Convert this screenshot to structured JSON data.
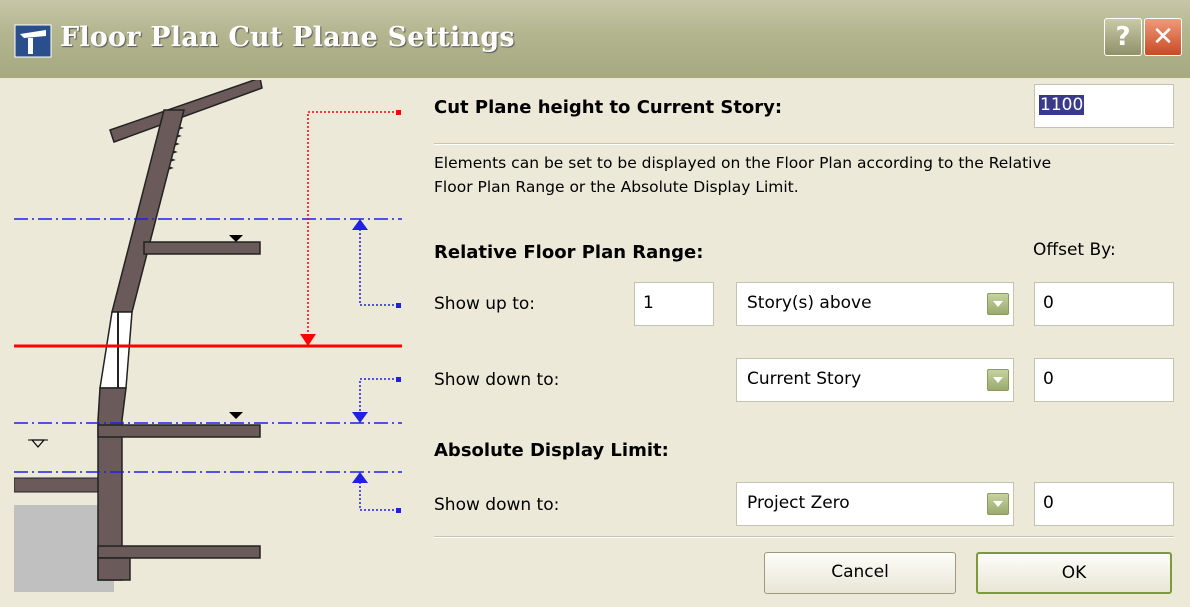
{
  "window": {
    "title": "Floor Plan Cut Plane Settings"
  },
  "titlebar": {
    "help_label": "?",
    "close_label": "✕"
  },
  "cut_plane": {
    "label": "Cut Plane height to Current Story:",
    "value": "1100"
  },
  "description": {
    "line1": "Elements can be set to be displayed on the Floor Plan according to the Relative",
    "line2": "Floor Plan Range or the Absolute Display Limit."
  },
  "relative_range": {
    "heading": "Relative Floor Plan Range:",
    "offset_heading": "Offset By:",
    "show_up": {
      "label": "Show up to:",
      "count": "1",
      "option": "Story(s) above",
      "offset": "0"
    },
    "show_down": {
      "label": "Show down to:",
      "option": "Current Story",
      "offset": "0"
    }
  },
  "absolute_limit": {
    "heading": "Absolute Display Limit:",
    "show_down": {
      "label": "Show down to:",
      "option": "Project Zero",
      "offset": "0"
    }
  },
  "buttons": {
    "cancel": "Cancel",
    "ok": "OK"
  },
  "colors": {
    "cut_line": "#ff0000",
    "level_line": "#2020e0",
    "wall": "#6b5a5a",
    "ground": "#c0c0c0"
  }
}
